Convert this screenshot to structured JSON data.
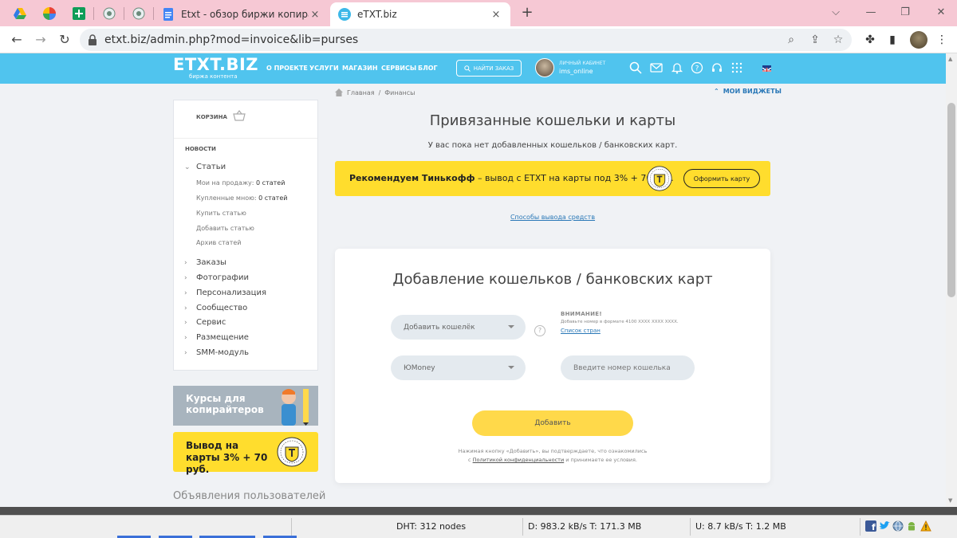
{
  "browser": {
    "tabs": [
      {
        "title": "Etxt - обзор биржи копирайтин",
        "active": false
      },
      {
        "title": "eTXT.biz",
        "active": true
      }
    ],
    "close_glyph": "×",
    "new_tab_glyph": "+",
    "window_controls": {
      "dropdown": "⌵",
      "minimize": "—",
      "restore": "❐",
      "close": "✕"
    },
    "url": "etxt.biz/admin.php?mod=invoice&lib=purses",
    "nav": {
      "back": "←",
      "forward": "→",
      "reload": "↻"
    },
    "toolbar_icons": {
      "zoom": "⌕",
      "share": "⇪",
      "bookmark": "☆",
      "extensions": "✤",
      "sidepanel": "▮",
      "menu": "⋮"
    }
  },
  "site": {
    "logo": "ETXT.BIZ",
    "logo_sub": "биржа контента",
    "menu": [
      "О ПРОЕКТЕ",
      "УСЛУГИ",
      "МАГАЗИН",
      "СЕРВИСЫ",
      "БЛОГ"
    ],
    "find_order": "НАЙТИ ЗАКАЗ",
    "cabinet_label": "ЛИЧНЫЙ КАБИНЕТ",
    "username": "ims_online"
  },
  "sidebar": {
    "cart": "КОРЗИНА",
    "news": "НОВОСТИ",
    "articles": "Статьи",
    "sub_items": [
      {
        "label": "Мои на продажу:",
        "value": "0 статей"
      },
      {
        "label": "Купленные мною:",
        "value": "0 статей"
      },
      {
        "label": "Купить статью",
        "value": ""
      },
      {
        "label": "Добавить статью",
        "value": ""
      },
      {
        "label": "Архив статей",
        "value": ""
      }
    ],
    "sections": [
      "Заказы",
      "Фотографии",
      "Персонализация",
      "Сообщество",
      "Сервис",
      "Размещение",
      "SMM-модуль"
    ],
    "promo_courses": "Курсы для копирайтеров",
    "promo_card": "Вывод на карты 3% + 70 руб.",
    "ads_title": "Объявления пользователей"
  },
  "main": {
    "breadcrumb": {
      "home": "Главная",
      "separator": "/",
      "current": "Финансы"
    },
    "widgets": "МОИ ВИДЖЕТЫ",
    "title": "Привязанные кошельки и карты",
    "no_cards": "У вас пока нет добавленных кошельков / банковских карт.",
    "banner_bold": "Рекомендуем Тинькофф",
    "banner_rest": " – вывод с ETXT на карты под 3% + 70 руб.",
    "banner_button": "Оформить карту",
    "withdraw_link": "Способы вывода средств"
  },
  "form": {
    "title": "Добавление кошельков / банковских карт",
    "wallet_select": "Добавить кошелёк",
    "type_select": "ЮMoney",
    "help": "?",
    "attention_title": "ВНИМАНИЕ!",
    "attention_text": "Добавьте номер в формате 4100 XXXX XXXX XXXX.",
    "countries_link": "Список стран",
    "wallet_placeholder": "Введите номер кошелька",
    "add_button": "Добавить",
    "consent_line1": "Нажимая кнопку «Добавить», вы подтверждаете, что ознакомились",
    "consent_pre": "с ",
    "consent_policy": "Политикой конфиденциальности",
    "consent_post": " и принимаете ее условия."
  },
  "statusbar": {
    "dht": "DHT: 312 nodes",
    "down": "D: 983.2 kB/s T: 171.3 MB",
    "up": "U: 8.7 kB/s T: 1.2 MB"
  },
  "colors": {
    "header": "#50c4ee",
    "yellow": "#ffdd2d",
    "link": "#2a78b7",
    "tab_bar": "#f6c8d4"
  }
}
